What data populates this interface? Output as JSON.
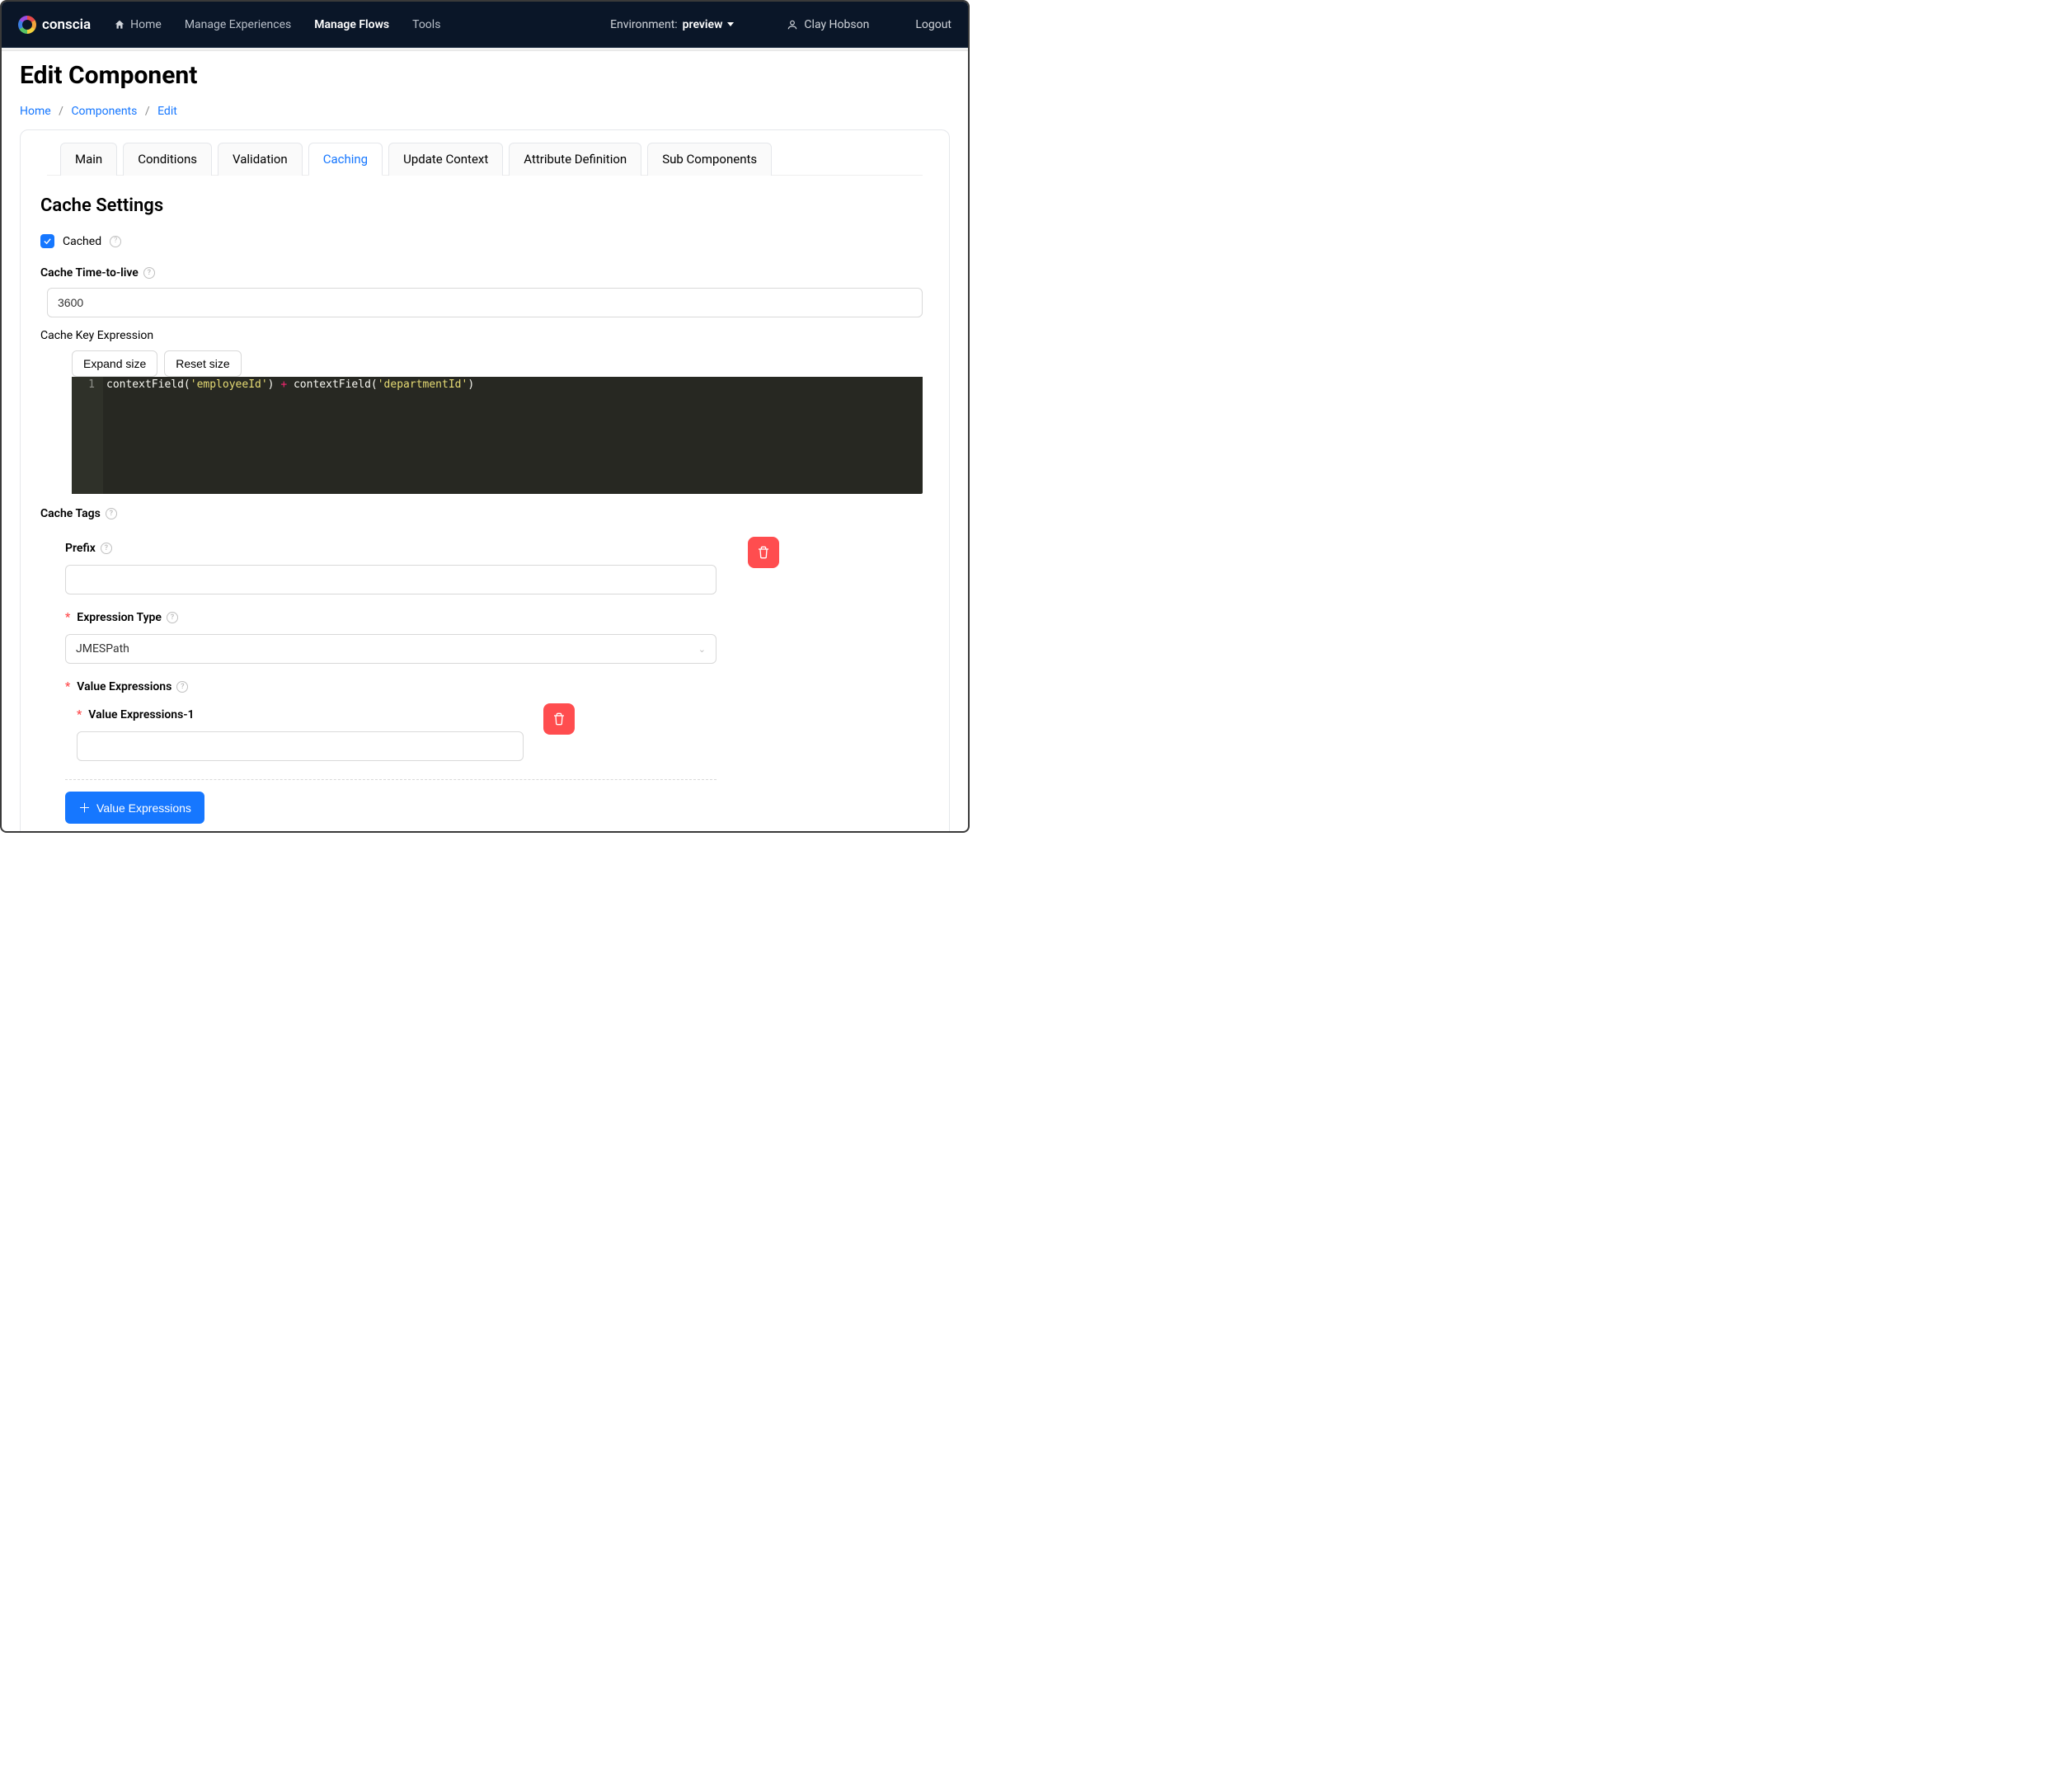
{
  "brand": "conscia",
  "nav": {
    "home": "Home",
    "manage_experiences": "Manage Experiences",
    "manage_flows": "Manage Flows",
    "tools": "Tools"
  },
  "environment_label": "Environment:",
  "environment_value": "preview",
  "user_name": "Clay Hobson",
  "logout": "Logout",
  "page_title": "Edit Component",
  "breadcrumb": {
    "home": "Home",
    "components": "Components",
    "edit": "Edit"
  },
  "tabs": {
    "main": "Main",
    "conditions": "Conditions",
    "validation": "Validation",
    "caching": "Caching",
    "update_context": "Update Context",
    "attribute_definition": "Attribute Definition",
    "sub_components": "Sub Components"
  },
  "section_title": "Cache Settings",
  "cached_label": "Cached",
  "ttl_label": "Cache Time-to-live",
  "ttl_value": "3600",
  "cache_key_expr_label": "Cache Key Expression",
  "btn_expand": "Expand size",
  "btn_reset": "Reset size",
  "code_line_no": "1",
  "code": {
    "fn1": "contextField",
    "lp1": "(",
    "str1": "'employeeId'",
    "rp1": ")",
    "plus": " + ",
    "fn2": "contextField",
    "lp2": "(",
    "str2": "'departmentId'",
    "rp2": ")"
  },
  "cache_tags_label": "Cache Tags",
  "prefix_label": "Prefix",
  "prefix_value": "",
  "expr_type_label": "Expression Type",
  "expr_type_value": "JMESPath",
  "value_exprs_label": "Value Expressions",
  "value_exprs_1_label": "Value Expressions-1",
  "value_exprs_1_value": "",
  "add_value_exprs_btn": "Value Expressions"
}
